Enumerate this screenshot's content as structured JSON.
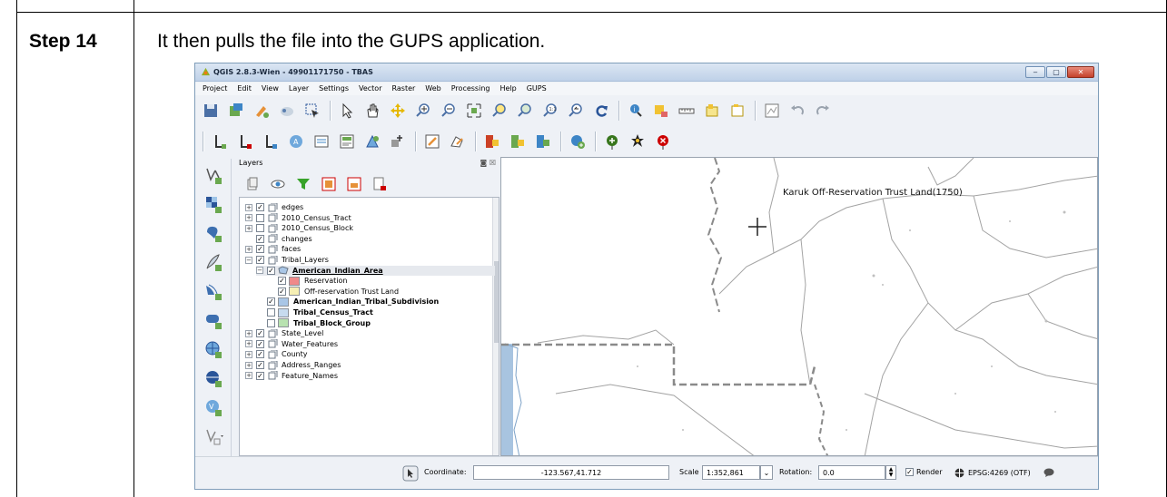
{
  "doc": {
    "step_label": "Step 14",
    "step_text": "It then pulls the file into the GUPS application."
  },
  "window": {
    "title": "QGIS 2.8.3-Wien - 49901171750 - TBAS",
    "minimize": "‒",
    "maximize": "▢",
    "close": "✕"
  },
  "menu": [
    "Project",
    "Edit",
    "View",
    "Layer",
    "Settings",
    "Vector",
    "Raster",
    "Web",
    "Processing",
    "Help",
    "GUPS"
  ],
  "layers_panel": {
    "title": "Layers",
    "header_icons": "◙ ☒",
    "tree": [
      {
        "label": "edges",
        "checked": true,
        "expander": "+",
        "indent": 0,
        "style": "normal"
      },
      {
        "label": "2010_Census_Tract",
        "checked": false,
        "expander": "+",
        "indent": 0,
        "style": "normal"
      },
      {
        "label": "2010_Census_Block",
        "checked": false,
        "expander": "+",
        "indent": 0,
        "style": "normal"
      },
      {
        "label": "changes",
        "checked": true,
        "expander": "",
        "indent": 0,
        "style": "normal"
      },
      {
        "label": "faces",
        "checked": true,
        "expander": "+",
        "indent": 0,
        "style": "normal"
      },
      {
        "label": "Tribal_Layers",
        "checked": true,
        "expander": "−",
        "indent": 0,
        "style": "normal"
      },
      {
        "label": "American_Indian_Area",
        "checked": true,
        "expander": "−",
        "indent": 1,
        "style": "bold",
        "selected": true
      },
      {
        "label": "Reservation",
        "checked": true,
        "expander": "",
        "indent": 2,
        "style": "normal",
        "swatch": "#f08a8a"
      },
      {
        "label": "Off-reservation Trust Land",
        "checked": true,
        "expander": "",
        "indent": 2,
        "style": "normal",
        "swatch": "#f6efb4"
      },
      {
        "label": "American_Indian_Tribal_Subdivision",
        "checked": true,
        "expander": "",
        "indent": 1,
        "style": "boldonly",
        "swatch": "#a9c6e6"
      },
      {
        "label": "Tribal_Census_Tract",
        "checked": false,
        "expander": "",
        "indent": 1,
        "style": "boldonly",
        "swatch": "#c7dbef"
      },
      {
        "label": "Tribal_Block_Group",
        "checked": false,
        "expander": "",
        "indent": 1,
        "style": "boldonly",
        "swatch": "#b8e2b0"
      },
      {
        "label": "State_Level",
        "checked": true,
        "expander": "+",
        "indent": 0,
        "style": "normal"
      },
      {
        "label": "Water_Features",
        "checked": true,
        "expander": "+",
        "indent": 0,
        "style": "normal"
      },
      {
        "label": "County",
        "checked": true,
        "expander": "+",
        "indent": 0,
        "style": "normal"
      },
      {
        "label": "Address_Ranges",
        "checked": true,
        "expander": "+",
        "indent": 0,
        "style": "normal"
      },
      {
        "label": "Feature_Names",
        "checked": true,
        "expander": "+",
        "indent": 0,
        "style": "normal"
      }
    ]
  },
  "map": {
    "label": "Karuk Off-Reservation Trust Land(1750)"
  },
  "statusbar": {
    "coordinate_label": "Coordinate:",
    "coordinate_value": "-123.567,41.712",
    "scale_label": "Scale",
    "scale_value": "1:352,861",
    "rotation_label": "Rotation:",
    "rotation_value": "0.0",
    "render_label": "Render",
    "render_checked": true,
    "crs": "EPSG:4269 (OTF)"
  },
  "colors": {
    "titlebar": "#c9d9ee",
    "water": "#a8c4e0",
    "boundary": "#8a8a8a",
    "reservation": "#f08a8a",
    "trust_land": "#f6efb4"
  }
}
